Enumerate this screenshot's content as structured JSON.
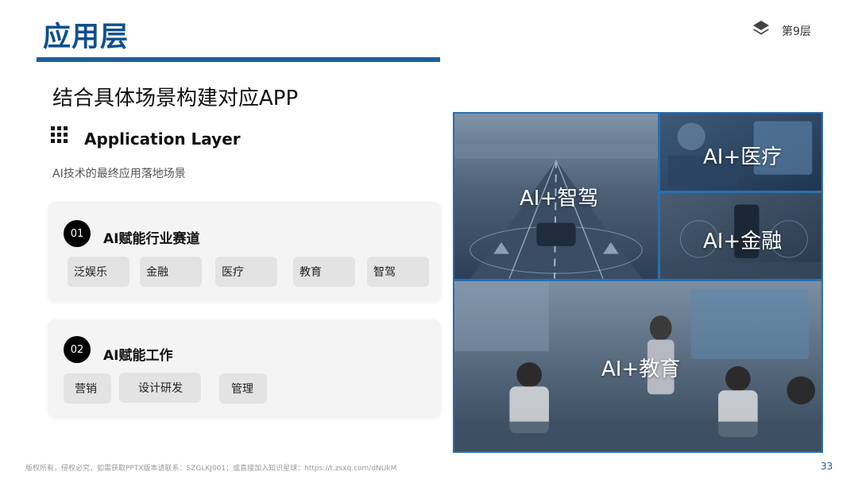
{
  "header": {
    "title": "应用层",
    "layer_label": "第9层"
  },
  "intro": {
    "subtitle": "结合具体场景构建对应APP",
    "layer_name_en": "Application Layer",
    "description": "AI技术的最终应用落地场景"
  },
  "sections": [
    {
      "number": "01",
      "title": "AI赋能行业赛道",
      "tags": [
        "泛娱乐",
        "金融",
        "医疗",
        "教育",
        "智驾"
      ]
    },
    {
      "number": "02",
      "title": "AI赋能工作",
      "tags": [
        "营销",
        "设计研发",
        "管理"
      ]
    }
  ],
  "tiles": [
    {
      "label": "AI+智驾"
    },
    {
      "label": "AI+医疗"
    },
    {
      "label": "AI+金融"
    },
    {
      "label": "AI+教育"
    }
  ],
  "footer": {
    "copyright": "版权所有，侵权必究，如需获取PPTX版本请联系：SZGLKJ001；或直接加入知识星球：https://t.zsxq.com/dNUkM",
    "page_number": "33"
  },
  "colors": {
    "brand": "#0f4f8f",
    "tile_border": "#2a6fb0",
    "card_bg": "#f4f4f4",
    "chip_bg": "#e3e3e3"
  },
  "icons": {
    "layer": "layers-icon",
    "app": "grid-icon"
  }
}
